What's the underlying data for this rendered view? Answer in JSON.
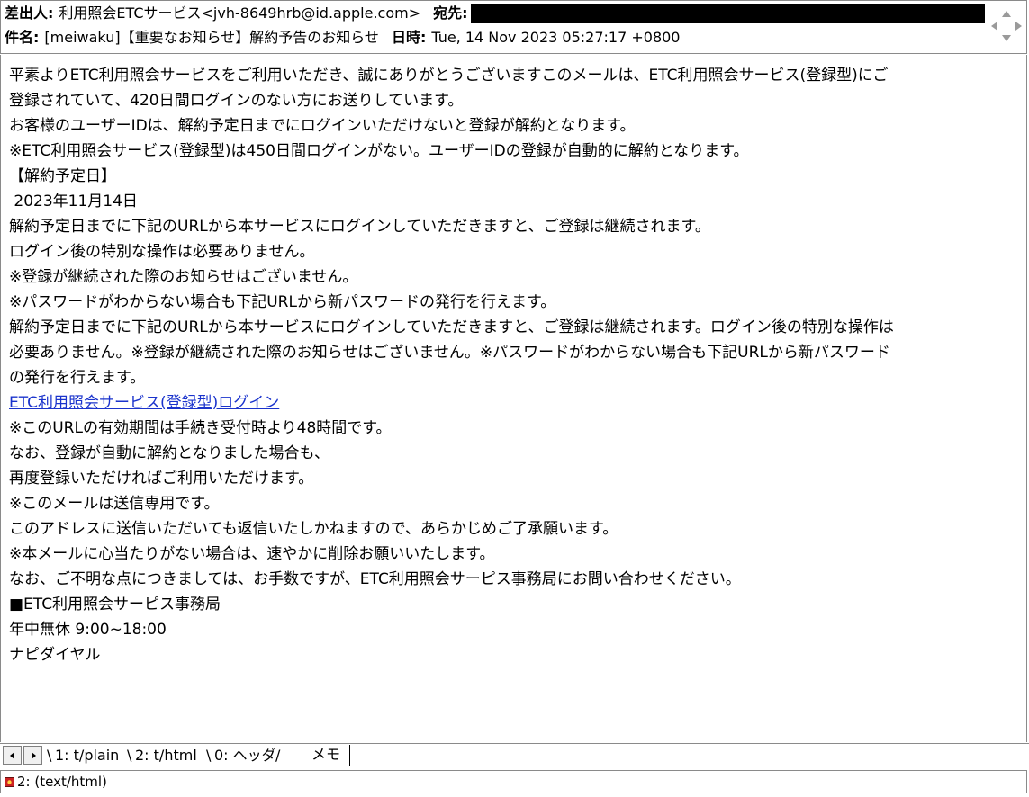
{
  "header": {
    "from_label": "差出人:",
    "from_value": "利用照会ETCサービス<jvh-8649hrb@id.apple.com>",
    "to_label": "宛先:",
    "subject_label": "件名:",
    "subject_value": "[meiwaku]【重要なお知らせ】解約予告のお知らせ",
    "date_label": "日時:",
    "date_value": "Tue, 14 Nov 2023 05:27:17 +0800"
  },
  "body": {
    "lines_before_link": [
      "平素よりETC利用照会サービスをご利用いただき、誠にありがとうございますこのメールは、ETC利用照会サービス(登録型)にご",
      "登録されていて、420日間ログインのない方にお送りしています。",
      "お客様のユーザーIDは、解約予定日までにログインいただけないと登録が解約となります。",
      "※ETC利用照会サービス(登録型)は450日間ログインがない。ユーザーIDの登録が自動的に解約となります。",
      "【解約予定日】",
      " 2023年11月14日",
      "解約予定日までに下記のURLから本サービスにログインしていただきますと、ご登録は継続されます。",
      "ログイン後の特別な操作は必要ありません。",
      "※登録が継続された際のお知らせはございません。",
      "※パスワードがわからない場合も下記URLから新パスワードの発行を行えます。",
      "解約予定日までに下記のURLから本サービスにログインしていただきますと、ご登録は継続されます。ログイン後の特別な操作は",
      "必要ありません。※登録が継続された際のお知らせはございません。※パスワードがわからない場合も下記URLから新パスワード",
      "の発行を行えます。"
    ],
    "link_text": "ETC利用照会サービス(登録型)ログイン",
    "lines_after_link": [
      "※このURLの有効期間は手続き受付時より48時間です。",
      "なお、登録が自動に解約となりました場合も、",
      "再度登録いただければご利用いただけます。",
      "※このメールは送信専用です。",
      "このアドレスに送信いただいても返信いたしかねますので、あらかじめご了承願います。",
      "※本メールに心当たりがない場合は、速やかに削除お願いいたします。",
      "なお、ご不明な点につきましては、お手数ですが、ETC利用照会サーピス事務局にお問い合わせください。",
      "■ETC利用照会サーピス事務局",
      "年中無休 9:00~18:00",
      "ナピダイヤル"
    ]
  },
  "tabs": [
    {
      "label": "1: t/plain"
    },
    {
      "label": "2: t/html"
    },
    {
      "label": "0: ヘッダ"
    },
    {
      "label": "メモ"
    }
  ],
  "status": {
    "text": "2: (text/html)"
  },
  "colors": {
    "link": "#1a33cc",
    "border": "#8a8a8a",
    "redaction": "#000000"
  },
  "icons": [
    "scroll-arrows-icon",
    "left-arrow-icon",
    "right-arrow-icon",
    "attachment-icon"
  ]
}
